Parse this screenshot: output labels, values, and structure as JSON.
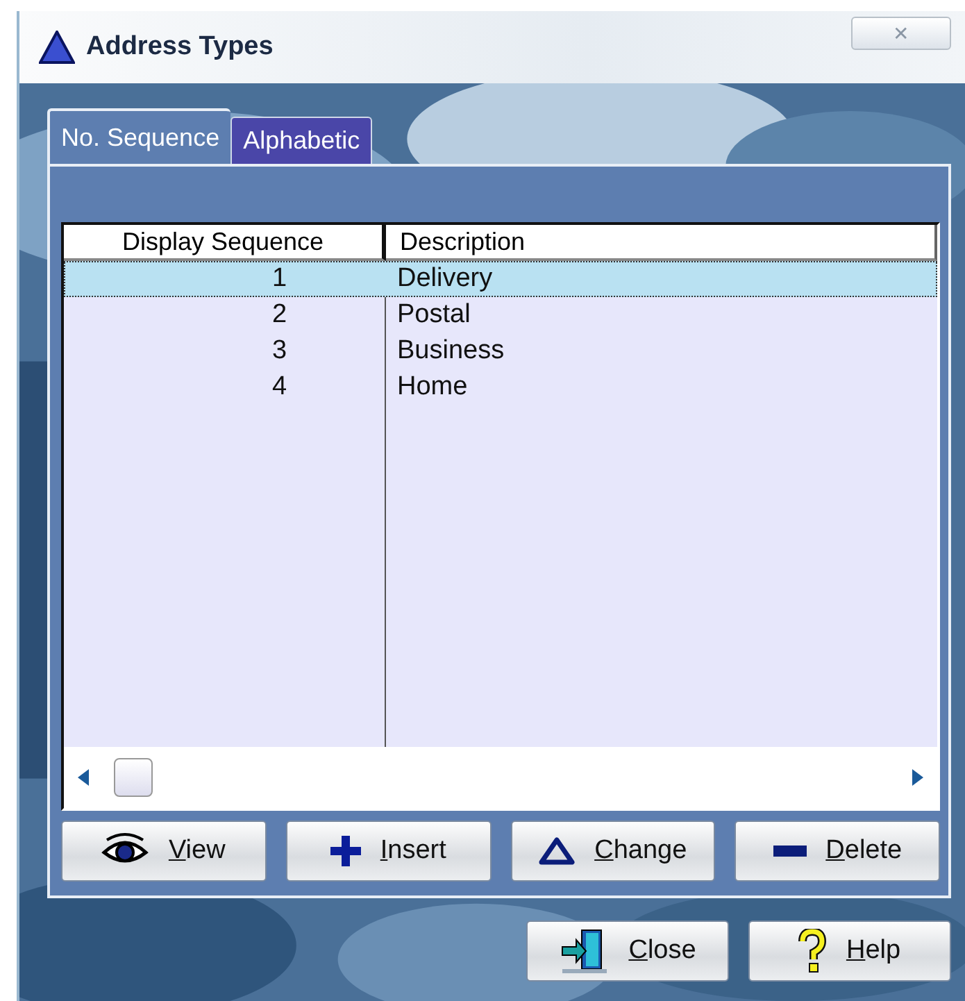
{
  "window": {
    "title": "Address Types",
    "close_glyph": "✕"
  },
  "tabs": [
    {
      "label": "No. Sequence",
      "selected": true
    },
    {
      "label": "Alphabetic",
      "selected": false
    }
  ],
  "table": {
    "columns": [
      "Display Sequence",
      "Description"
    ],
    "rows": [
      {
        "sequence": "1",
        "description": "Delivery",
        "selected": true
      },
      {
        "sequence": "2",
        "description": "Postal",
        "selected": false
      },
      {
        "sequence": "3",
        "description": "Business",
        "selected": false
      },
      {
        "sequence": "4",
        "description": "Home",
        "selected": false
      }
    ]
  },
  "actions": [
    {
      "kind": "view",
      "label": "View"
    },
    {
      "kind": "insert",
      "label": "Insert"
    },
    {
      "kind": "change",
      "label": "Change"
    },
    {
      "kind": "delete",
      "label": "Delete"
    }
  ],
  "footer": [
    {
      "kind": "close",
      "label": "Close"
    },
    {
      "kind": "help",
      "label": "Help"
    }
  ]
}
